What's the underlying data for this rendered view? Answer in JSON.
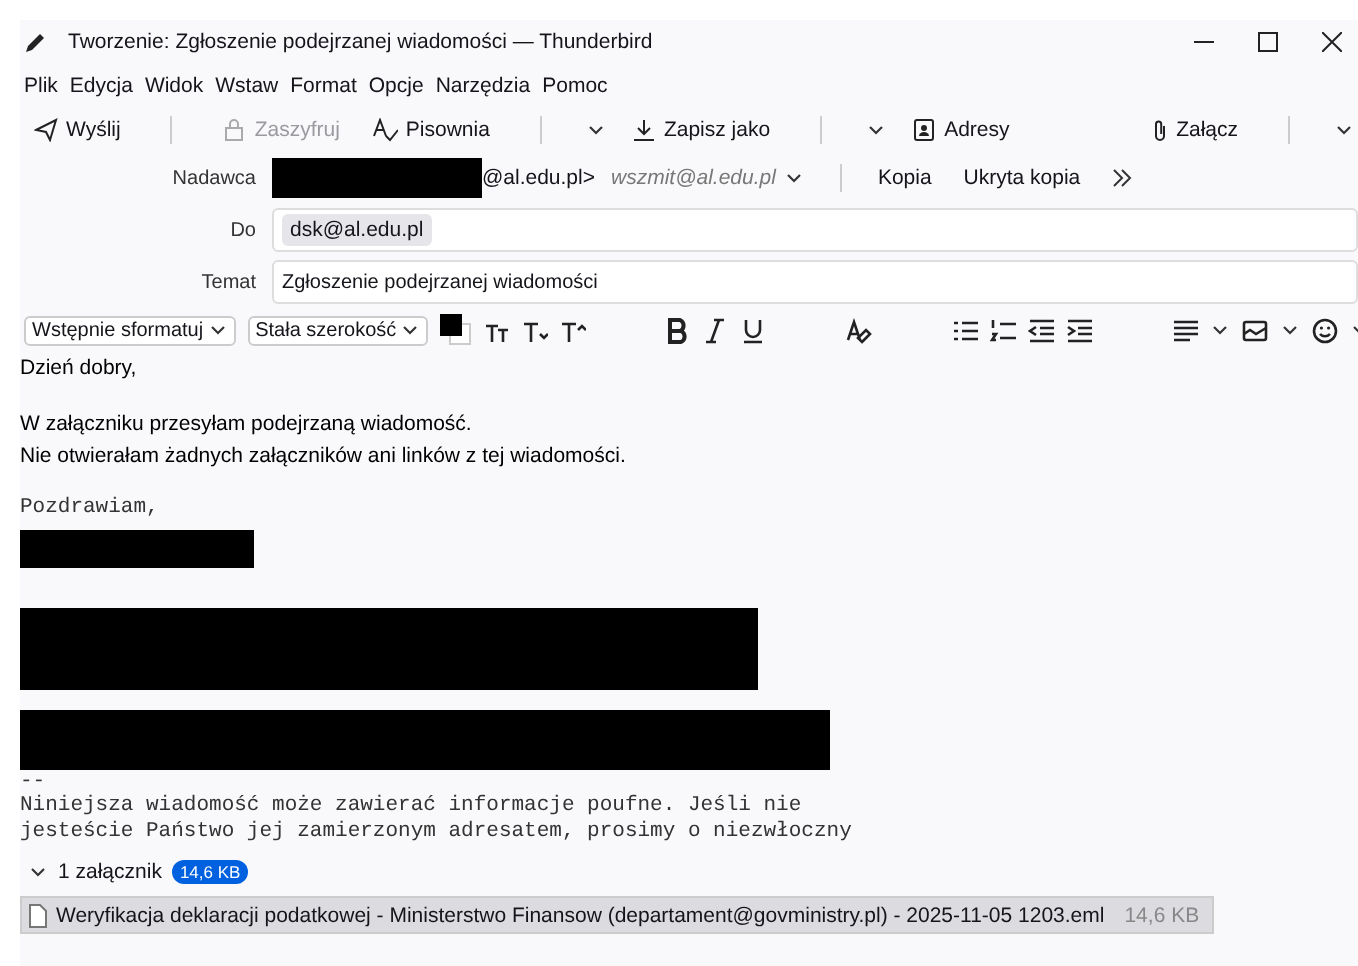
{
  "window": {
    "title": "Tworzenie: Zgłoszenie podejrzanej wiadomości — Thunderbird"
  },
  "menu": [
    "Plik",
    "Edycja",
    "Widok",
    "Wstaw",
    "Format",
    "Opcje",
    "Narzędzia",
    "Pomoc"
  ],
  "toolbar": [
    {
      "label": "Wyślij",
      "disabled": false,
      "menu": false
    },
    {
      "label": "Zaszyfruj",
      "disabled": true,
      "menu": false
    },
    {
      "label": "Pisownia",
      "disabled": false,
      "menu": true
    },
    {
      "label": "Zapisz jako",
      "disabled": false,
      "menu": true
    },
    {
      "label": "Adresy",
      "disabled": false,
      "menu": false
    }
  ],
  "toolbar_right": {
    "label": "Załącz",
    "menu": true
  },
  "header": {
    "from": {
      "label": "Nadawca",
      "address": "@al.edu.pl>",
      "identity": "wszmit@al.edu.pl"
    },
    "links": [
      "Kopia",
      "Ukryta kopia"
    ],
    "to": {
      "label": "Do",
      "recipients": [
        "dsk@al.edu.pl"
      ]
    },
    "subject": {
      "label": "Temat",
      "value": "Zgłoszenie podejrzanej wiadomości"
    }
  },
  "format_bar": {
    "paragraph": "Wstępnie sformatuj",
    "font": "Stała szerokość"
  },
  "body": [
    {
      "kind": "text",
      "lines": [
        "Dzień dobry,"
      ]
    },
    {
      "kind": "text",
      "lines": [
        "W załączniku przesyłam podejrzaną wiadomość.",
        "Nie otwierałam żadnych załączników ani linków z tej wiadomości."
      ]
    },
    {
      "kind": "mono",
      "lines": [
        "Pozdrawiam,"
      ]
    },
    {
      "kind": "redacted"
    },
    {
      "kind": "redacted"
    },
    {
      "kind": "redacted"
    },
    {
      "kind": "mono",
      "lines": [
        "--",
        "Niniejsza wiadomość może zawierać informacje poufne. Jeśli nie",
        "jesteście Państwo jej zamierzonym adresatem, prosimy o niezwłoczny"
      ]
    }
  ],
  "attachments": {
    "expanded": true,
    "count": "1 załącznik",
    "total_size": "14,6 KB",
    "files": [
      {
        "name": "Weryfikacja deklaracji podatkowej - Ministerstwo Finansow (departament@govministry.pl) - 2025-11-05 1203.eml",
        "size": "14,6 KB"
      }
    ]
  }
}
